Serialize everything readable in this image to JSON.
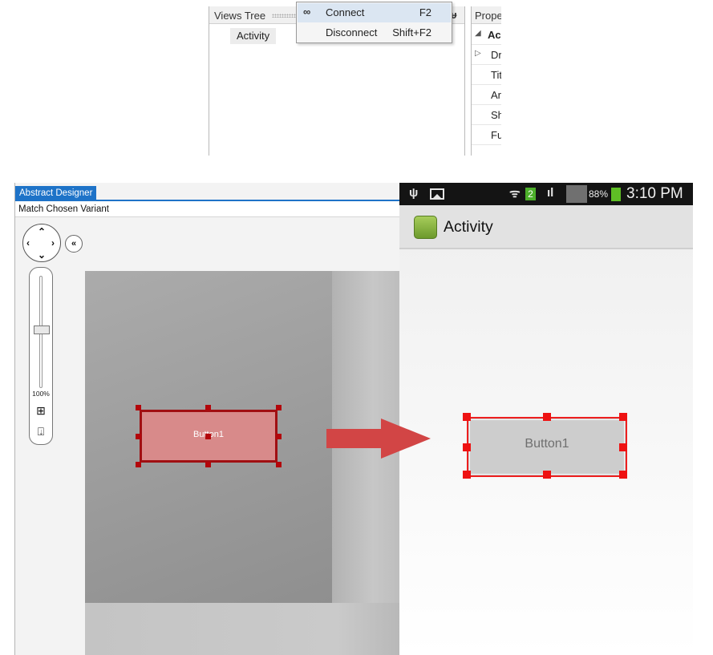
{
  "context_menu": {
    "items": [
      {
        "label": "Connect",
        "shortcut": "F2",
        "icon": "link-icon",
        "highlighted": true
      },
      {
        "label": "Disconnect",
        "shortcut": "Shift+F2"
      }
    ]
  },
  "views_tree": {
    "title": "Views Tree",
    "nodes": [
      "Activity"
    ]
  },
  "properties": {
    "title": "Prope",
    "rows": [
      {
        "glyph": "◢",
        "text": "Ac"
      },
      {
        "glyph": "▷",
        "text": "Dr"
      },
      {
        "glyph": "",
        "text": "Tit"
      },
      {
        "glyph": "",
        "text": "Ar"
      },
      {
        "glyph": "",
        "text": "Sh"
      },
      {
        "glyph": "",
        "text": "Fu"
      }
    ]
  },
  "designer": {
    "tab": "Abstract Designer",
    "subtitle": "Match Chosen Variant",
    "zoom": "100%",
    "selected_view": "Button1"
  },
  "phone": {
    "status": {
      "battery": "88%",
      "time": "3:10 PM",
      "notification_count": "2"
    },
    "activity_title": "Activity",
    "button_label": "Button1"
  },
  "colors": {
    "designer_tab": "#1e73c8",
    "selection_dark": "#a00f12",
    "selection_red": "#ee1f1f",
    "arrow": "#d24545"
  }
}
